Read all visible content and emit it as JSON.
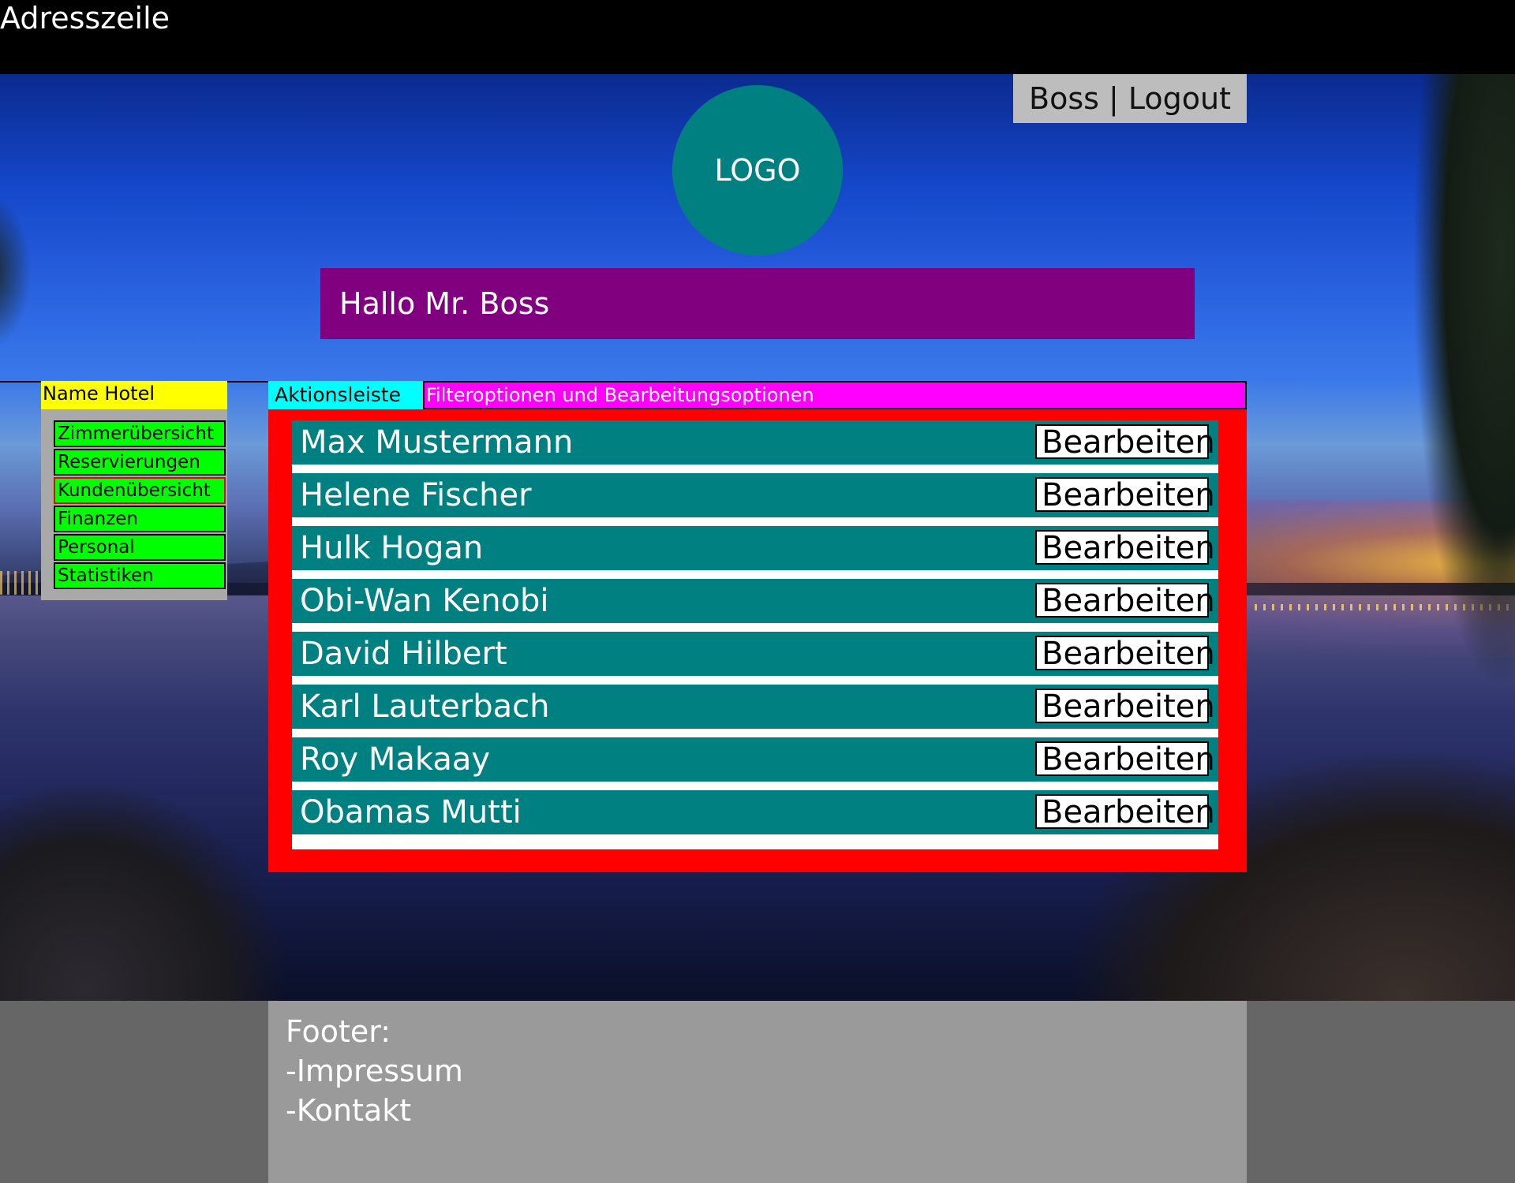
{
  "address_bar": {
    "label": "Adresszeile"
  },
  "user_nav": {
    "user": "Boss",
    "separator": " | ",
    "logout": "Logout"
  },
  "logo": {
    "label": "LOGO"
  },
  "greeting": "Hallo Mr. Boss",
  "sidebar": {
    "hotel_name": "Name Hotel",
    "items": [
      {
        "label": "Zimmerübersicht",
        "active": false
      },
      {
        "label": "Reservierungen",
        "active": false
      },
      {
        "label": "Kundenübersicht",
        "active": true
      },
      {
        "label": "Finanzen",
        "active": false
      },
      {
        "label": "Personal",
        "active": false
      },
      {
        "label": "Statistiken",
        "active": false
      }
    ]
  },
  "action_bar": {
    "label": "Aktionsleiste",
    "filter_label": "Filteroptionen und Bearbeitungsoptionen"
  },
  "customers": {
    "edit_label": "Bearbeiten",
    "rows": [
      {
        "name": "Max Mustermann"
      },
      {
        "name": "Helene Fischer"
      },
      {
        "name": "Hulk Hogan"
      },
      {
        "name": "Obi-Wan Kenobi"
      },
      {
        "name": "David Hilbert"
      },
      {
        "name": "Karl Lauterbach"
      },
      {
        "name": "Roy Makaay"
      },
      {
        "name": "Obamas Mutti"
      }
    ]
  },
  "footer": {
    "title": "Footer:",
    "links": [
      "-Impressum",
      "-Kontakt"
    ]
  },
  "colors": {
    "logo": "#008080",
    "greeting": "#800080",
    "hotel_name": "#ffff00",
    "menu_item": "#00ff00",
    "action_label": "#00ffff",
    "filter_bar": "#ff00ff",
    "list_frame": "#ff0000",
    "row": "#008080",
    "footer": "#9a9a9a"
  }
}
